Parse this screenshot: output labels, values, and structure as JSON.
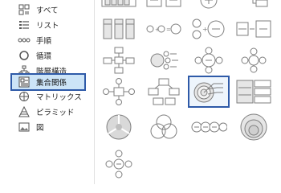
{
  "categories": [
    {
      "label": "すべて",
      "icon": "all-icon"
    },
    {
      "label": "リスト",
      "icon": "list-icon"
    },
    {
      "label": "手順",
      "icon": "process-icon"
    },
    {
      "label": "循環",
      "icon": "cycle-icon"
    },
    {
      "label": "階層構造",
      "icon": "hierarchy-icon"
    },
    {
      "label": "集合関係",
      "icon": "relationship-icon",
      "selected": true
    },
    {
      "label": "マトリックス",
      "icon": "matrix-icon"
    },
    {
      "label": "ピラミッド",
      "icon": "pyramid-icon"
    },
    {
      "label": "図",
      "icon": "picture-icon"
    }
  ],
  "colors": {
    "selection_border": "#2e5aa8",
    "selection_fill": "#cce4f7",
    "diagram_stroke": "#7f7f7f",
    "diagram_fill": "#e6e6e6"
  },
  "selected_thumbnail": "target-diagram"
}
